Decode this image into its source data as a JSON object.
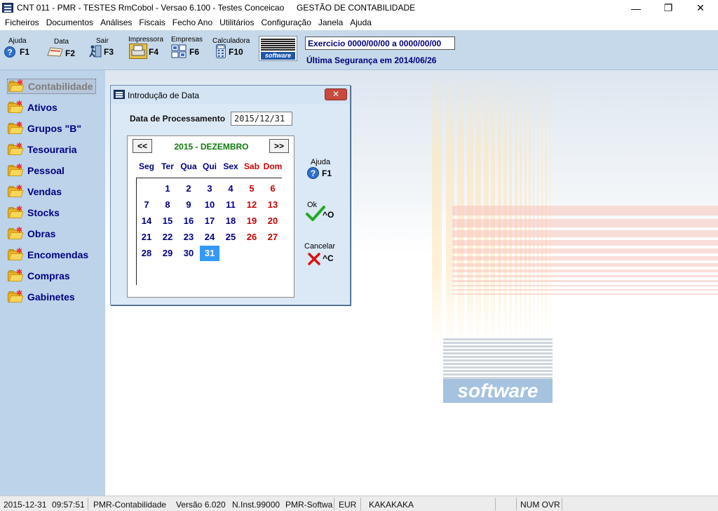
{
  "titlebar": {
    "title": "CNT 011 - PMR - TESTES RmCobol - Versao 6.100 - Testes Conceicao",
    "subtitle": "GESTÃO DE CONTABILIDADE",
    "minimize_glyph": "—",
    "maximize_glyph": "❐",
    "close_glyph": "✕"
  },
  "menu": [
    "Ficheiros",
    "Documentos",
    "Análises",
    "Fiscais",
    "Fecho Ano",
    "Utilitários",
    "Configuração",
    "Janela",
    "Ajuda"
  ],
  "toolbar": {
    "buttons": [
      {
        "label": "Ajuda",
        "key": "F1",
        "icon": "help-icon"
      },
      {
        "label": "Data",
        "key": "F2",
        "icon": "calendar-icon"
      },
      {
        "label": "Sair",
        "key": "F3",
        "icon": "exit-icon"
      },
      {
        "label": "Impressora",
        "key": "F4",
        "icon": "printer-icon"
      },
      {
        "label": "Empresas",
        "key": "F6",
        "icon": "companies-icon"
      },
      {
        "label": "Calculadora",
        "key": "F10",
        "icon": "calculator-icon"
      }
    ],
    "logo_text": "software",
    "exercicio": "Exercicio 0000/00/00 a 0000/00/00",
    "seguranca": "Última Segurança em 2014/06/26"
  },
  "sidebar": {
    "items": [
      "Contabilidade",
      "Ativos",
      "Grupos \"B\"",
      "Tesouraria",
      "Pessoal",
      "Vendas",
      "Stocks",
      "Obras",
      "Encomendas",
      "Compras",
      "Gabinetes"
    ]
  },
  "background_logo_text": "software",
  "dialog": {
    "title": "Introdução de Data",
    "close_glyph": "✕",
    "date_label": "Data de Processamento",
    "date_value": "2015/12/31",
    "calendar": {
      "prev": "<<",
      "next": ">>",
      "month_label": "2015 - DEZEMBRO",
      "weekdays": [
        "Seg",
        "Ter",
        "Qua",
        "Qui",
        "Sex",
        "Sab",
        "Dom"
      ],
      "weeks": [
        [
          "",
          "1",
          "2",
          "3",
          "4",
          "5",
          "6"
        ],
        [
          "7",
          "8",
          "9",
          "10",
          "11",
          "12",
          "13"
        ],
        [
          "14",
          "15",
          "16",
          "17",
          "18",
          "19",
          "20"
        ],
        [
          "21",
          "22",
          "23",
          "24",
          "25",
          "26",
          "27"
        ],
        [
          "28",
          "29",
          "30",
          "31",
          "",
          "",
          ""
        ]
      ],
      "selected": "31"
    },
    "buttons": {
      "help": {
        "label": "Ajuda",
        "key": "F1"
      },
      "ok": {
        "label": "Ok",
        "key": "^O"
      },
      "cancel": {
        "label": "Cancelar",
        "key": "^C"
      }
    }
  },
  "statusbar": [
    "2015-12-31",
    "09:57:51",
    "PMR-Contabilidade",
    "Versão  6.020",
    "N.Inst.99000",
    "PMR-Softwar",
    "EUR",
    "KAKAKAKA",
    "NUM OVR"
  ]
}
